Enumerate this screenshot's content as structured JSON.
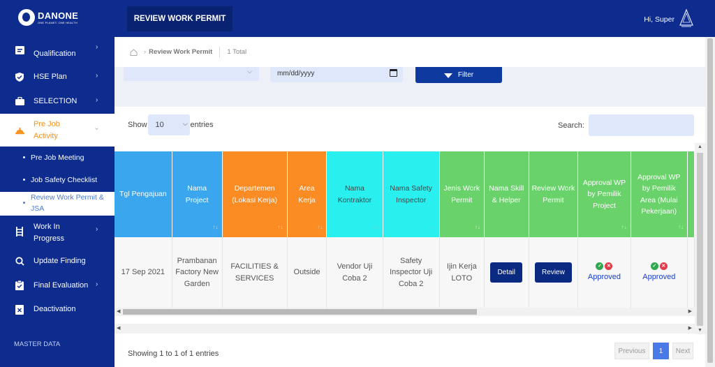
{
  "brand": {
    "name": "DANONE",
    "tagline": "ONE PLANET. ONE HEALTH"
  },
  "header": {
    "page_tab": "REVIEW WORK PERMIT",
    "greeting": "Hi,  Super"
  },
  "sidebar": {
    "items": [
      {
        "label": "Qualification",
        "icon": "list-icon"
      },
      {
        "label": "HSE Plan",
        "icon": "shield-check-icon"
      },
      {
        "label": "SELECTION",
        "icon": "briefcase-icon"
      },
      {
        "label": "Pre Job Activity",
        "icon": "hard-hat-icon"
      },
      {
        "label": "Work In Progress",
        "icon": "ladder-icon"
      },
      {
        "label": "Update Finding",
        "icon": "search-icon"
      },
      {
        "label": "Final Evaluation",
        "icon": "clipboard-check-icon"
      },
      {
        "label": "Deactivation",
        "icon": "archive-icon"
      }
    ],
    "sub_items": [
      {
        "label": "Pre Job Meeting"
      },
      {
        "label": "Job Safety Checklist"
      },
      {
        "label": "Review Work Permit & JSA"
      }
    ],
    "section_label": "MASTER DATA"
  },
  "breadcrumb": {
    "current": "Review Work Permit",
    "total": "1 Total"
  },
  "filters": {
    "date_placeholder": "mm/dd/yyyy",
    "filter_button": "Filter"
  },
  "table_controls": {
    "show_label": "Show",
    "entries_value": "10",
    "entries_label": "entries",
    "search_label": "Search:"
  },
  "table": {
    "headers": [
      "Tgl Pengajuan",
      "Nama Project",
      "Departemen (Lokasi Kerja)",
      "Area Kerja",
      "Nama Kontraktor",
      "Nama Safety Inspector",
      "Jenis Work Permit",
      "Nama Skill & Helper",
      "Review Work Permit",
      "Approval WP by Pemilik Project",
      "Approval WP by Pemilik Area (Mulai Pekerjaan)"
    ],
    "row": {
      "tgl": "17 Sep 2021",
      "project": "Prambanan Factory New Garden",
      "departemen": "FACILITIES & SERVICES",
      "area": "Outside",
      "kontraktor": "Vendor Uji Coba 2",
      "inspector": "Safety Inspector Uji Coba 2",
      "jenis": "Ijin Kerja LOTO",
      "detail_button": "Detail",
      "review_button": "Review",
      "approval_project": "Approved",
      "approval_area": "Approved"
    }
  },
  "footer": {
    "showing": "Showing 1 to 1 of 1 entries",
    "prev": "Previous",
    "page": "1",
    "next": "Next"
  },
  "colors": {
    "nav": "#0e2c8e",
    "accent": "#f7931e",
    "header_blue": "#39a6ee",
    "header_orange": "#fb8c23",
    "header_cyan": "#29f0ef",
    "header_green": "#6ad26a"
  }
}
